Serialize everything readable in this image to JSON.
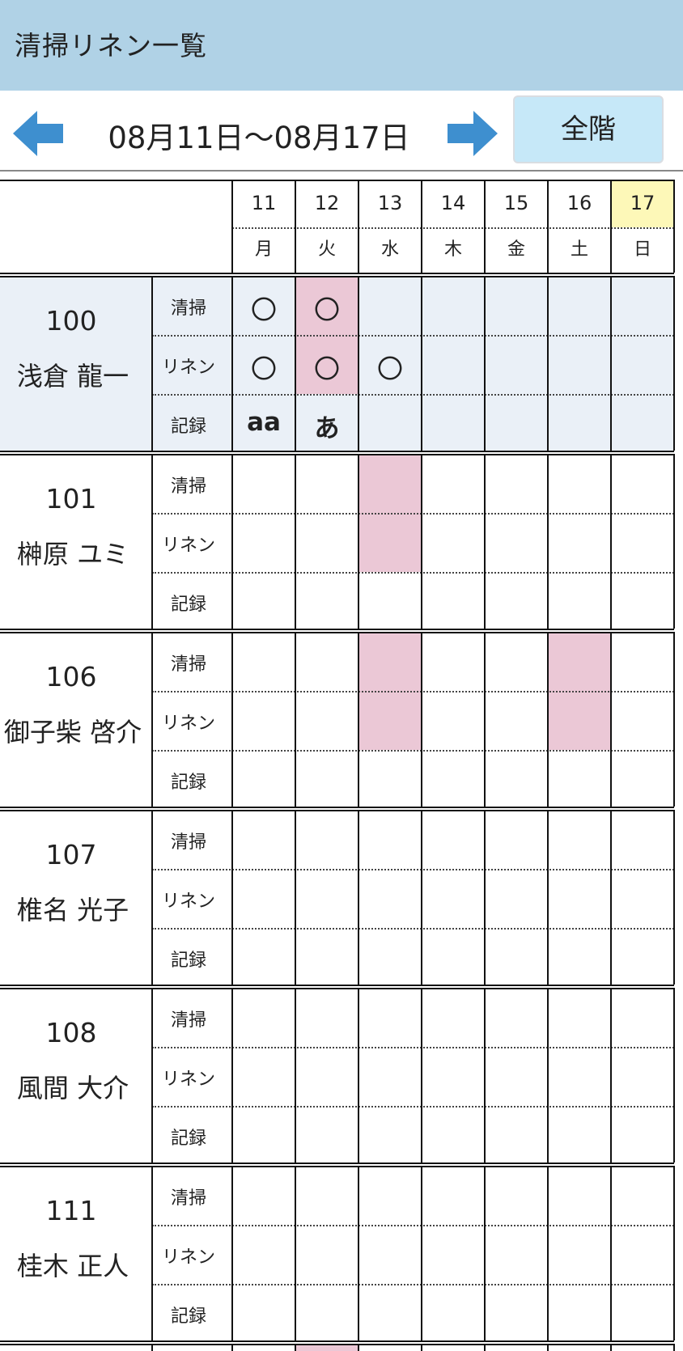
{
  "header": {
    "title": "清掃リネン一覧"
  },
  "nav": {
    "prev_icon": "arrow-left-icon",
    "next_icon": "arrow-right-icon",
    "date_range": "08月11日〜08月17日",
    "floor_button": "全階"
  },
  "colors": {
    "header_bg": "#b0d2e6",
    "accent_arrow": "#3e8fcf",
    "floor_button_bg": "#c6e8f8",
    "selected_room_bg": "#eaf0f7",
    "highlight_cell": "#ebc8d6",
    "today_header": "#fdf8b8"
  },
  "days": [
    {
      "day": "11",
      "dow": "月"
    },
    {
      "day": "12",
      "dow": "火"
    },
    {
      "day": "13",
      "dow": "水"
    },
    {
      "day": "14",
      "dow": "木"
    },
    {
      "day": "15",
      "dow": "金"
    },
    {
      "day": "16",
      "dow": "土"
    },
    {
      "day": "17",
      "dow": "日",
      "today": true
    }
  ],
  "row_labels": [
    "清掃",
    "リネン",
    "記録"
  ],
  "rooms": [
    {
      "number": "100",
      "guest": "浅倉 龍一",
      "selected": true,
      "cleaning": [
        "〇",
        "〇",
        "",
        "",
        "",
        "",
        ""
      ],
      "linen": [
        "〇",
        "〇",
        "〇",
        "",
        "",
        "",
        ""
      ],
      "record": [
        "aa",
        "あ",
        "",
        "",
        "",
        "",
        ""
      ],
      "highlight_days": [
        1
      ]
    },
    {
      "number": "101",
      "guest": "榊原 ユミ",
      "cleaning": [
        "",
        "",
        "",
        "",
        "",
        "",
        ""
      ],
      "linen": [
        "",
        "",
        "",
        "",
        "",
        "",
        ""
      ],
      "record": [
        "",
        "",
        "",
        "",
        "",
        "",
        ""
      ],
      "highlight_days": [
        2
      ]
    },
    {
      "number": "106",
      "guest": "御子柴 啓介",
      "cleaning": [
        "",
        "",
        "",
        "",
        "",
        "",
        ""
      ],
      "linen": [
        "",
        "",
        "",
        "",
        "",
        "",
        ""
      ],
      "record": [
        "",
        "",
        "",
        "",
        "",
        "",
        ""
      ],
      "highlight_days": [
        2,
        5
      ]
    },
    {
      "number": "107",
      "guest": "椎名 光子",
      "cleaning": [
        "",
        "",
        "",
        "",
        "",
        "",
        ""
      ],
      "linen": [
        "",
        "",
        "",
        "",
        "",
        "",
        ""
      ],
      "record": [
        "",
        "",
        "",
        "",
        "",
        "",
        ""
      ],
      "highlight_days": []
    },
    {
      "number": "108",
      "guest": "風間 大介",
      "cleaning": [
        "",
        "",
        "",
        "",
        "",
        "",
        ""
      ],
      "linen": [
        "",
        "",
        "",
        "",
        "",
        "",
        ""
      ],
      "record": [
        "",
        "",
        "",
        "",
        "",
        "",
        ""
      ],
      "highlight_days": []
    },
    {
      "number": "111",
      "guest": "桂木 正人",
      "cleaning": [
        "",
        "",
        "",
        "",
        "",
        "",
        ""
      ],
      "linen": [
        "",
        "",
        "",
        "",
        "",
        "",
        ""
      ],
      "record": [
        "",
        "",
        "",
        "",
        "",
        "",
        ""
      ],
      "highlight_days": []
    }
  ]
}
